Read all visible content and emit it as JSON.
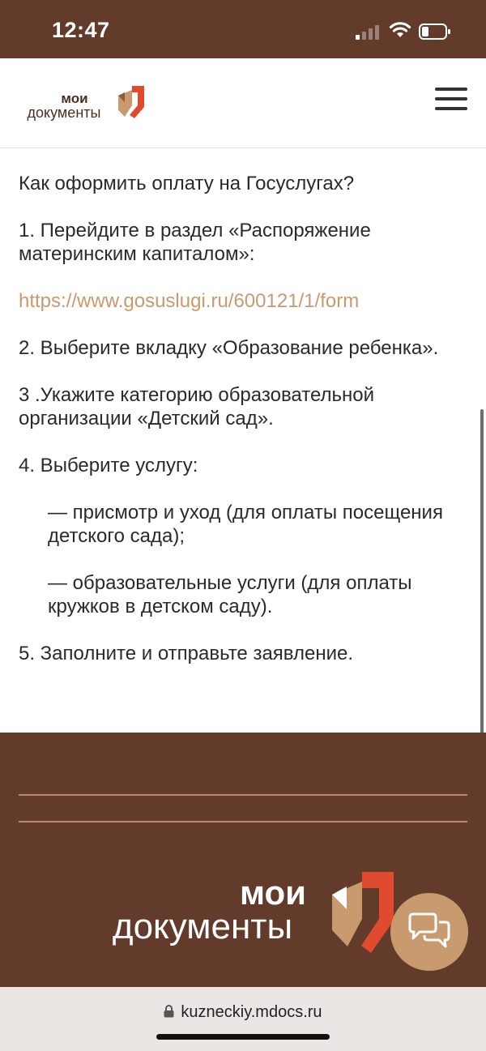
{
  "status_bar": {
    "time": "12:47",
    "battery_percent": 25
  },
  "header": {
    "logo_top": "мои",
    "logo_bottom": "документы",
    "menu_icon": "hamburger-icon"
  },
  "article": {
    "question": "Как оформить оплату на Госуслугах?",
    "step1": "1. Перейдите в раздел «Распоряжение материнским капиталом»:",
    "link": "https://www.gosuslugi.ru/600121/1/form",
    "step2": "2. Выберите вкладку «Образование ребенка».",
    "step3": "3 .Укажите категорию образовательной организации «Детский сад».",
    "step4": "4. Выберите услугу:",
    "option1": "— присмотр и уход (для оплаты посещения детского сада);",
    "option2": "— образовательные услуги (для оплаты кружков в детском саду).",
    "step5": "5. Заполните и отправьте заявление."
  },
  "footer": {
    "logo_top": "мои",
    "logo_bottom": "документы",
    "chat_icon": "chat-bubbles-icon"
  },
  "browser": {
    "url": "kuzneckiy.mdocs.ru",
    "lock_icon": "lock-icon"
  },
  "colors": {
    "brand_brown": "#633b2b",
    "accent_tan": "#c99a6d",
    "logo_red": "#e04a2f"
  }
}
